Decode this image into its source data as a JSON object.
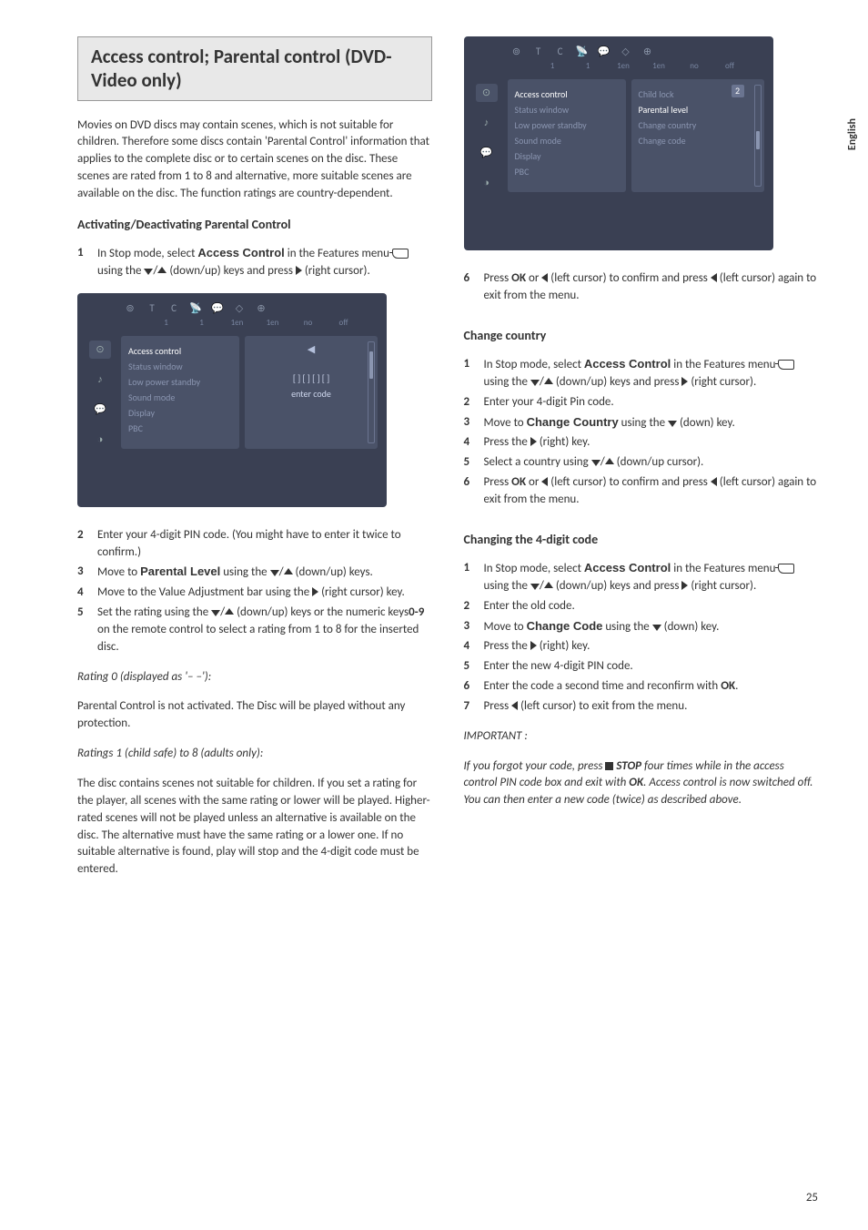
{
  "sidebar": {
    "language": "English"
  },
  "pageNumber": "25",
  "title": "Access control; Parental control (DVD-Video only)",
  "intro": "Movies on DVD discs may contain scenes, which is not suitable for children. Therefore some discs contain 'Parental Control' information that applies to the complete disc or to certain scenes on the disc. These scenes are rated from 1 to 8 and alternative, more suitable scenes are available on the disc. The function ratings are country-dependent.",
  "section1": {
    "heading": "Activating/Deactivating Parental Control",
    "step1a": "In Stop mode, select ",
    "step1b": " in the Features menu ",
    "step1c": " using the ",
    "step1d": " (down/up) keys and press ",
    "step1e": " (right cursor).",
    "accessControl": "Access Control",
    "step2": "Enter your 4-digit PIN code.  (You might have to enter it twice to confirm.)",
    "step3a": "Move to ",
    "step3b": " using the ",
    "step3c": " (down/up) keys.",
    "parentalLevel": "Parental Level",
    "step4a": "Move to the Value Adjustment bar using the ",
    "step4b": " (right cursor) key.",
    "step5a": "Set the rating using the ",
    "step5b": " (down/up) keys or the numeric keys",
    "step5c": "0-9",
    "step5d": " on the remote control to select a rating from 1 to 8 for the inserted disc."
  },
  "rating0": {
    "heading": "Rating 0 (displayed as '– –'):",
    "body": "Parental Control is not activated. The Disc will be played without any protection."
  },
  "rating1": {
    "heading": "Ratings 1 (child safe) to 8 (adults only):",
    "body": "The disc contains scenes not suitable for children. If you set a rating for the player, all scenes with the same rating or lower will be played. Higher-rated scenes will not be played unless an alternative is available on the disc. The alternative must have the same rating or a lower one. If no suitable alternative is found, play will stop and the 4-digit code must be entered."
  },
  "step6Left": {
    "a": "Press ",
    "b": "OK",
    "c": " or ",
    "d": " (left cursor) to confirm and press ",
    "e": " (left cursor) again to exit from the menu."
  },
  "section2": {
    "heading": "Change country",
    "step1a": "In Stop mode, select ",
    "step1b": " in the Features menu ",
    "step1c": " using the ",
    "step1d": " (down/up) keys and press ",
    "step1e": " (right cursor).",
    "step2": "Enter your 4-digit Pin code.",
    "step3a": "Move to ",
    "step3b": " using the ",
    "step3c": " (down) key.",
    "changeCountry": "Change Country",
    "step4a": "Press the ",
    "step4b": " (right) key.",
    "step5a": "Select a country using ",
    "step5b": " (down/up cursor).",
    "step6a": "Press ",
    "step6b": "OK",
    "step6c": " or ",
    "step6d": " (left cursor) to confirm and press ",
    "step6e": " (left cursor) again to exit from the menu."
  },
  "section3": {
    "heading": "Changing the 4-digit code",
    "step1a": "In Stop mode, select ",
    "step1b": " in the Features menu ",
    "step1c": " using the ",
    "step1d": " (down/up) keys and press ",
    "step1e": " (right cursor).",
    "step2": "Enter the old code.",
    "step3a": "Move to ",
    "step3b": " using the ",
    "step3c": " (down) key.",
    "changeCode": "Change Code",
    "step4a": "Press the ",
    "step4b": " (right) key.",
    "step5": "Enter the new 4-digit PIN code.",
    "step6a": "Enter the code a second time and reconfirm with ",
    "step6b": "OK",
    "step6c": ".",
    "step7a": "Press ",
    "step7b": " (left cursor) to exit from the menu."
  },
  "important": {
    "heading": "IMPORTANT :",
    "a": "If you forgot your code, press ",
    "b": " STOP",
    "c": " four times while in the access control PIN code box and exit with ",
    "d": "OK",
    "e": ". Access control is now switched off. You can then enter a new code (twice) as described above."
  },
  "screenshot1": {
    "tabs": {
      "icons": [
        "⊚",
        "T",
        "C",
        "📡",
        "💬",
        "◇",
        "⊕"
      ]
    },
    "sub": [
      "",
      "1",
      "1",
      "1en",
      "1en",
      "no",
      "off"
    ],
    "sideIcons": [
      "⊙",
      "♪",
      "💬",
      "◑"
    ],
    "leftPanel": [
      "Access control",
      "Status window",
      "Low power standby",
      "Sound mode",
      "Display",
      "PBC"
    ],
    "rightPanel": {
      "arrow": "◀",
      "line1": "[ ] [ ] [ ] [ ]",
      "line2": "enter code"
    }
  },
  "screenshot2": {
    "tabs": {
      "icons": [
        "⊚",
        "T",
        "C",
        "📡",
        "💬",
        "◇",
        "⊕"
      ]
    },
    "sub": [
      "",
      "1",
      "1",
      "1en",
      "1en",
      "no",
      "off"
    ],
    "sideIcons": [
      "⊙",
      "♪",
      "💬",
      "◑"
    ],
    "leftPanel": [
      "Access control",
      "Status window",
      "Low power standby",
      "Sound mode",
      "Display",
      "PBC"
    ],
    "rightPanel": [
      "Child lock",
      "Parental level",
      "Change country",
      "Change code"
    ],
    "badge": "2"
  }
}
